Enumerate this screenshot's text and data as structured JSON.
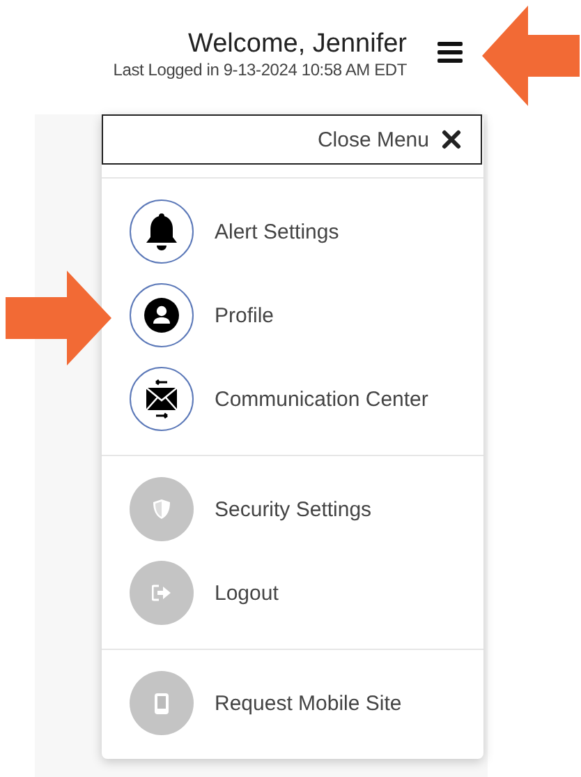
{
  "header": {
    "welcome": "Welcome, Jennifer",
    "last_login": "Last Logged in 9-13-2024 10:58 AM EDT"
  },
  "menu": {
    "close_label": "Close Menu",
    "groups": [
      {
        "kind": "outlined",
        "items": [
          {
            "label": "Alert Settings",
            "kind": "bell"
          },
          {
            "label": "Profile",
            "kind": "user"
          },
          {
            "label": "Communication Center",
            "kind": "mail"
          }
        ]
      },
      {
        "kind": "muted",
        "items": [
          {
            "label": "Security Settings",
            "kind": "shield"
          },
          {
            "label": "Logout",
            "kind": "logout"
          }
        ]
      },
      {
        "kind": "muted",
        "items": [
          {
            "label": "Request Mobile Site",
            "kind": "phone"
          }
        ]
      }
    ]
  }
}
